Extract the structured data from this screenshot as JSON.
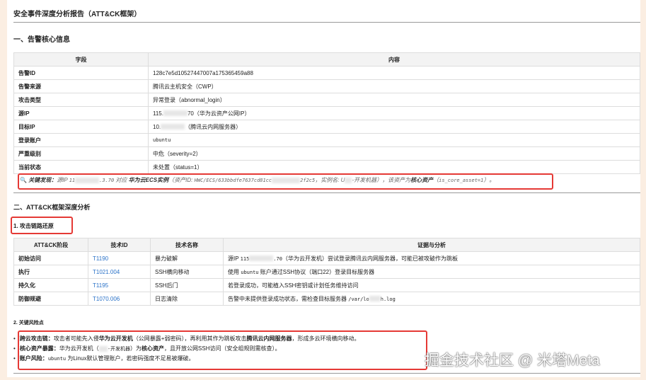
{
  "title": "安全事件深度分析报告（ATT&CK框架）",
  "section1": {
    "heading": "一、告警核心信息",
    "headers": [
      "字段",
      "内容"
    ],
    "rows": [
      {
        "k": "告警ID",
        "v": "128c7e5d10527447007a175365459a88"
      },
      {
        "k": "告警来源",
        "v": "腾讯云主机安全（CWP）"
      },
      {
        "k": "攻击类型",
        "v": "异常登录（abnormal_login）"
      },
      {
        "k": "源IP",
        "v1": "115.",
        "v2": "70（华为云资产公网IP）"
      },
      {
        "k": "目标IP",
        "v1": "10.",
        "v2": "（腾讯云内网服务器）"
      },
      {
        "k": "登录账户",
        "v": "ubuntu"
      },
      {
        "k": "严重级别",
        "v": "中危（severity=2）"
      },
      {
        "k": "当前状态",
        "v": "未处置（status=1）"
      }
    ],
    "callout": {
      "icon": "magnifier-icon",
      "label": "关键发现：",
      "t1": "源IP ",
      "ip1": "11",
      "ip2": ".3.70",
      "t2": " 对应 ",
      "b1": "华为云ECS实例",
      "t3": "（资产ID: ",
      "id1": "HWC/ECS/633bbdfe7637cd81cc",
      "id2": "2f2c5",
      "t4": "，实例名: ",
      "n1": "U",
      "n2": "-开发机器",
      "t5": "），该资产为",
      "b2": "核心资产",
      "t6": "（",
      "code": "is_core_asset=1",
      "t7": "）。"
    }
  },
  "section2": {
    "heading": "二、ATT&CK框架深度分析",
    "sub1": "1. 攻击链路还原",
    "headers": [
      "ATT&CK阶段",
      "技术ID",
      "技术名称",
      "证据与分析"
    ],
    "rows": [
      {
        "stage": "初始访问",
        "id": "T1190",
        "name": "暴力破解",
        "e1": "源IP ",
        "ea": "115",
        "eb": ".70",
        "e2": "（华为云开发机）尝试登录腾讯云内网服务器，可能已被攻破作为跳板"
      },
      {
        "stage": "执行",
        "id": "T1021.004",
        "name": "SSH横向移动",
        "e1": "使用 ",
        "code": "ubuntu",
        "e2": " 账户通过SSH协议（端口22）登录目标服务器"
      },
      {
        "stage": "持久化",
        "id": "T1195",
        "name": "SSH后门",
        "e1": "若登录成功，可能植入SSH密钥或计划任务维持访问"
      },
      {
        "stage": "防御规避",
        "id": "T1070.006",
        "name": "日志清除",
        "e1": "告警中未提供登录成功状态，需检查目标服务器 ",
        "ea": "/var/lo",
        "eb": "h.log"
      }
    ],
    "sub2": "2. 关键风险点",
    "risks": [
      {
        "b": "跨云攻击链：",
        "t1": "攻击者可能先入侵",
        "b2": "华为云开发机",
        "t2": "（公网暴露+弱密码），再利用其作为跳板攻击",
        "b3": "腾讯云内网服务器",
        "t3": "，形成多云环境横向移动。"
      },
      {
        "b": "核心资产暴露：",
        "t1": "华为云开发机（",
        "m": "-开发机器",
        "t2": "）为",
        "b2": "核心资产",
        "t3": "，且开放公网SSH访问（安全组规则需核查）。"
      },
      {
        "b": "账户风险：",
        "code": "ubuntu",
        "t1": " 为Linux默认管理账户，若密码强度不足易被爆破。"
      }
    ]
  },
  "watermark": "掘金技术社区 @ 米塔Meta",
  "colors": {
    "highlight": "#e53935",
    "link": "#2a72c8",
    "background": "#fbeee2"
  }
}
